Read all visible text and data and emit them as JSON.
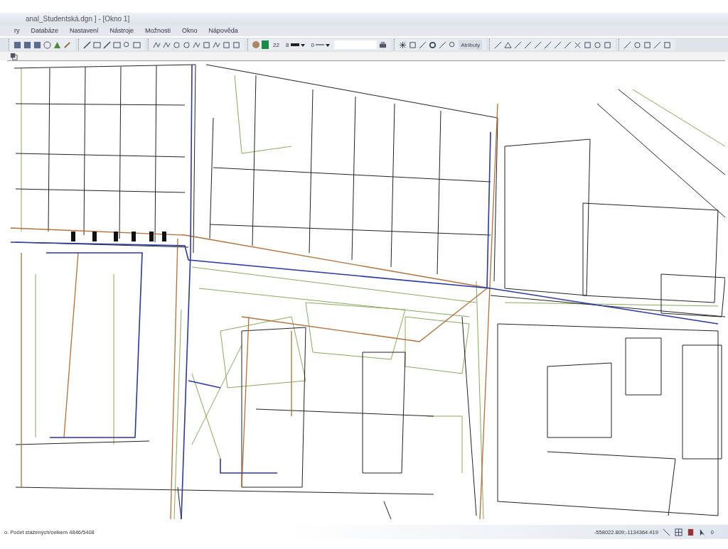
{
  "window": {
    "title": "anal_Studentská.dgn ] - [Okno 1]"
  },
  "menu": [
    {
      "label": "ry"
    },
    {
      "label": "Databáze"
    },
    {
      "label": "Nastavení"
    },
    {
      "label": "Nástroje"
    },
    {
      "label": "Možnosti"
    },
    {
      "label": "Okno"
    },
    {
      "label": "Nápověda"
    }
  ],
  "toolbar": {
    "color_number": "22",
    "weight": "8",
    "style": "0",
    "attributes_button": "Atributy"
  },
  "status_bar": {
    "message": "o. Počet stažených/celkem 4846/5408",
    "coordinates": "-558022.809;-1134364.419",
    "cursor_count": "0"
  }
}
